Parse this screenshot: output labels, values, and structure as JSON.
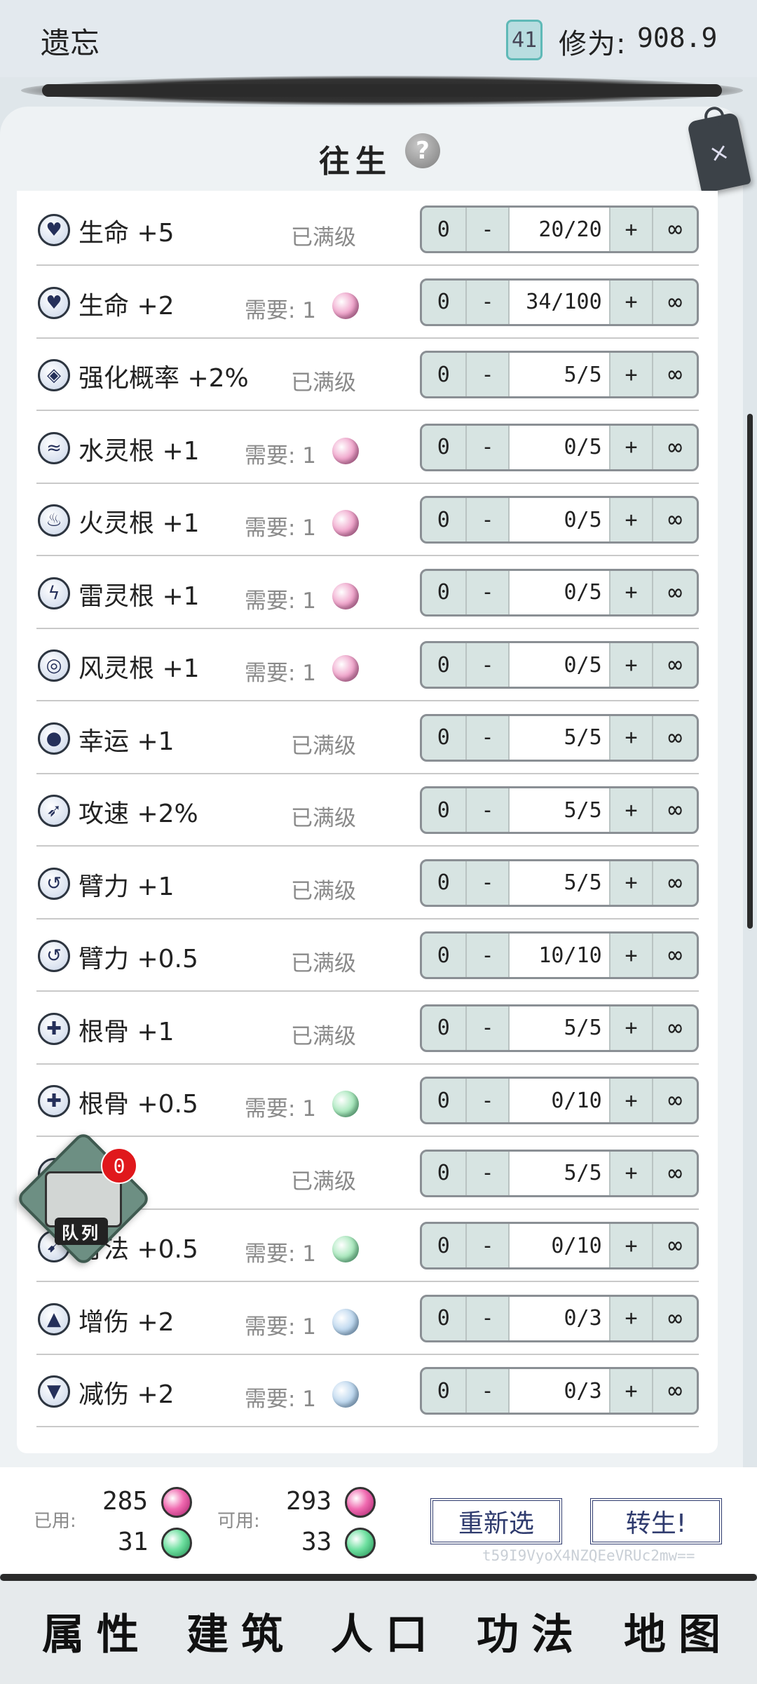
{
  "header": {
    "app_name": "遗忘",
    "level": "41",
    "cultivation_label": "修为:",
    "cultivation_value": "908.9"
  },
  "panel": {
    "title": "往生",
    "help_icon": "?",
    "close_icon": "×"
  },
  "rows": [
    {
      "icon": "heart-icon",
      "name": "生命 +5",
      "status": "已满级",
      "value": "20/20"
    },
    {
      "icon": "heart-icon",
      "name": "生命 +2",
      "req_label": "需要: 1",
      "req_orb": "pink",
      "value": "34/100"
    },
    {
      "icon": "enhance-icon",
      "name": "强化概率 +2%",
      "status": "已满级",
      "value": "5/5"
    },
    {
      "icon": "water-icon",
      "name": "水灵根 +1",
      "req_label": "需要: 1",
      "req_orb": "pink",
      "value": "0/5"
    },
    {
      "icon": "fire-icon",
      "name": "火灵根 +1",
      "req_label": "需要: 1",
      "req_orb": "pink",
      "value": "0/5"
    },
    {
      "icon": "thunder-icon",
      "name": "雷灵根 +1",
      "req_label": "需要: 1",
      "req_orb": "pink",
      "value": "0/5"
    },
    {
      "icon": "wind-icon",
      "name": "风灵根 +1",
      "req_label": "需要: 1",
      "req_orb": "pink",
      "value": "0/5"
    },
    {
      "icon": "luck-icon",
      "name": "幸运 +1",
      "status": "已满级",
      "value": "5/5"
    },
    {
      "icon": "attack-speed-icon",
      "name": "攻速 +2%",
      "status": "已满级",
      "value": "5/5"
    },
    {
      "icon": "arm-icon",
      "name": "臂力 +1",
      "status": "已满级",
      "value": "5/5"
    },
    {
      "icon": "arm-icon",
      "name": "臂力 +0.5",
      "status": "已满级",
      "value": "10/10"
    },
    {
      "icon": "bone-icon",
      "name": "根骨 +1",
      "status": "已满级",
      "value": "5/5"
    },
    {
      "icon": "bone-icon",
      "name": "根骨 +0.5",
      "req_label": "需要: 1",
      "req_orb": "green",
      "value": "0/10"
    },
    {
      "icon": "body-icon",
      "name": "+1",
      "status": "已满级",
      "value": "5/5"
    },
    {
      "icon": "body-icon",
      "name": "身法 +0.5",
      "req_label": "需要: 1",
      "req_orb": "green",
      "value": "0/10"
    },
    {
      "icon": "damage-up-icon",
      "name": "增伤 +2",
      "req_label": "需要: 1",
      "req_orb": "blue",
      "value": "0/3"
    },
    {
      "icon": "damage-down-icon",
      "name": "减伤 +2",
      "req_label": "需要: 1",
      "req_orb": "blue",
      "value": "0/3"
    }
  ],
  "stepper": {
    "zero": "0",
    "minus": "-",
    "plus": "+",
    "infinity": "∞"
  },
  "queue": {
    "label": "队列",
    "badge": "0"
  },
  "resources": {
    "used_label": "已用:",
    "used_pink": "285",
    "used_green": "31",
    "available_label": "可用:",
    "available_pink": "293",
    "available_green": "33"
  },
  "actions": {
    "reselect": "重新选",
    "rebirth": "转生!"
  },
  "watermark": "t59I9VyoX4NZQEeVRUc2mw==",
  "nav": [
    "属性",
    "建筑",
    "人口",
    "功法",
    "地图"
  ],
  "colors": {
    "accent": "#2f3b6e",
    "pink_orb": "#f06ab0",
    "green_orb": "#6ee0a0",
    "badge": "#e0181c"
  }
}
